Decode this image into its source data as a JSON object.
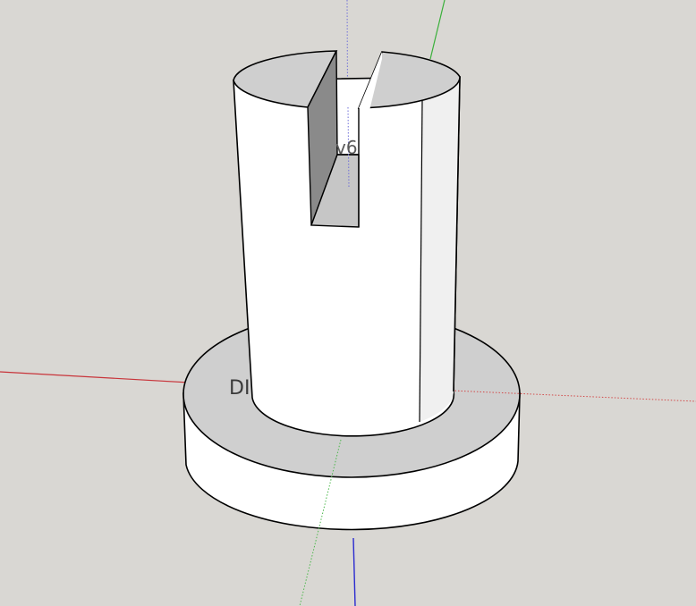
{
  "viewport": {
    "background_color": "#d9d7d3",
    "axis_colors": {
      "red_axis": "#c8343a",
      "green_axis": "#3ab03a",
      "blue_axis": "#2a2ad0"
    }
  },
  "model": {
    "face_color": "#ffffff",
    "shaded_face_color": "#c8c8c8",
    "dark_face_color": "#8a8a8a",
    "edge_color": "#000000"
  },
  "labels": {
    "dimension_left": "DI",
    "dimension_top": "v6"
  }
}
